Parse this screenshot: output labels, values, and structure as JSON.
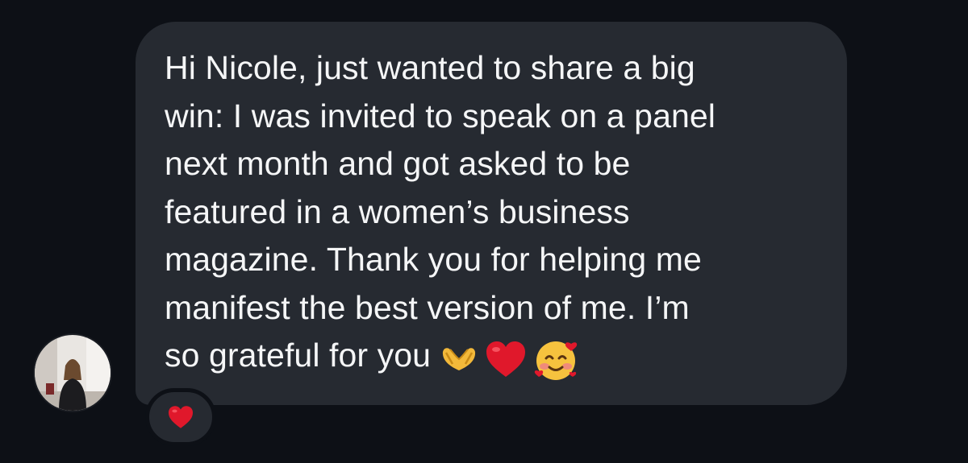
{
  "message": {
    "lines": [
      "Hi Nicole, just wanted to share a big",
      "win: I was invited to speak on a panel",
      "next month and got asked to be",
      "featured in a women’s business",
      "magazine. Thank you for helping me",
      "manifest the best version of me. I’m",
      "so grateful for you"
    ],
    "emojis": [
      "heart-hands-icon",
      "red-heart-icon",
      "smiling-face-with-hearts-icon"
    ]
  },
  "reaction": {
    "icon": "red-heart-icon"
  },
  "colors": {
    "background": "#0d1016",
    "bubble": "#262a31",
    "text": "#f5f6f7",
    "heart": "#e0182b"
  }
}
